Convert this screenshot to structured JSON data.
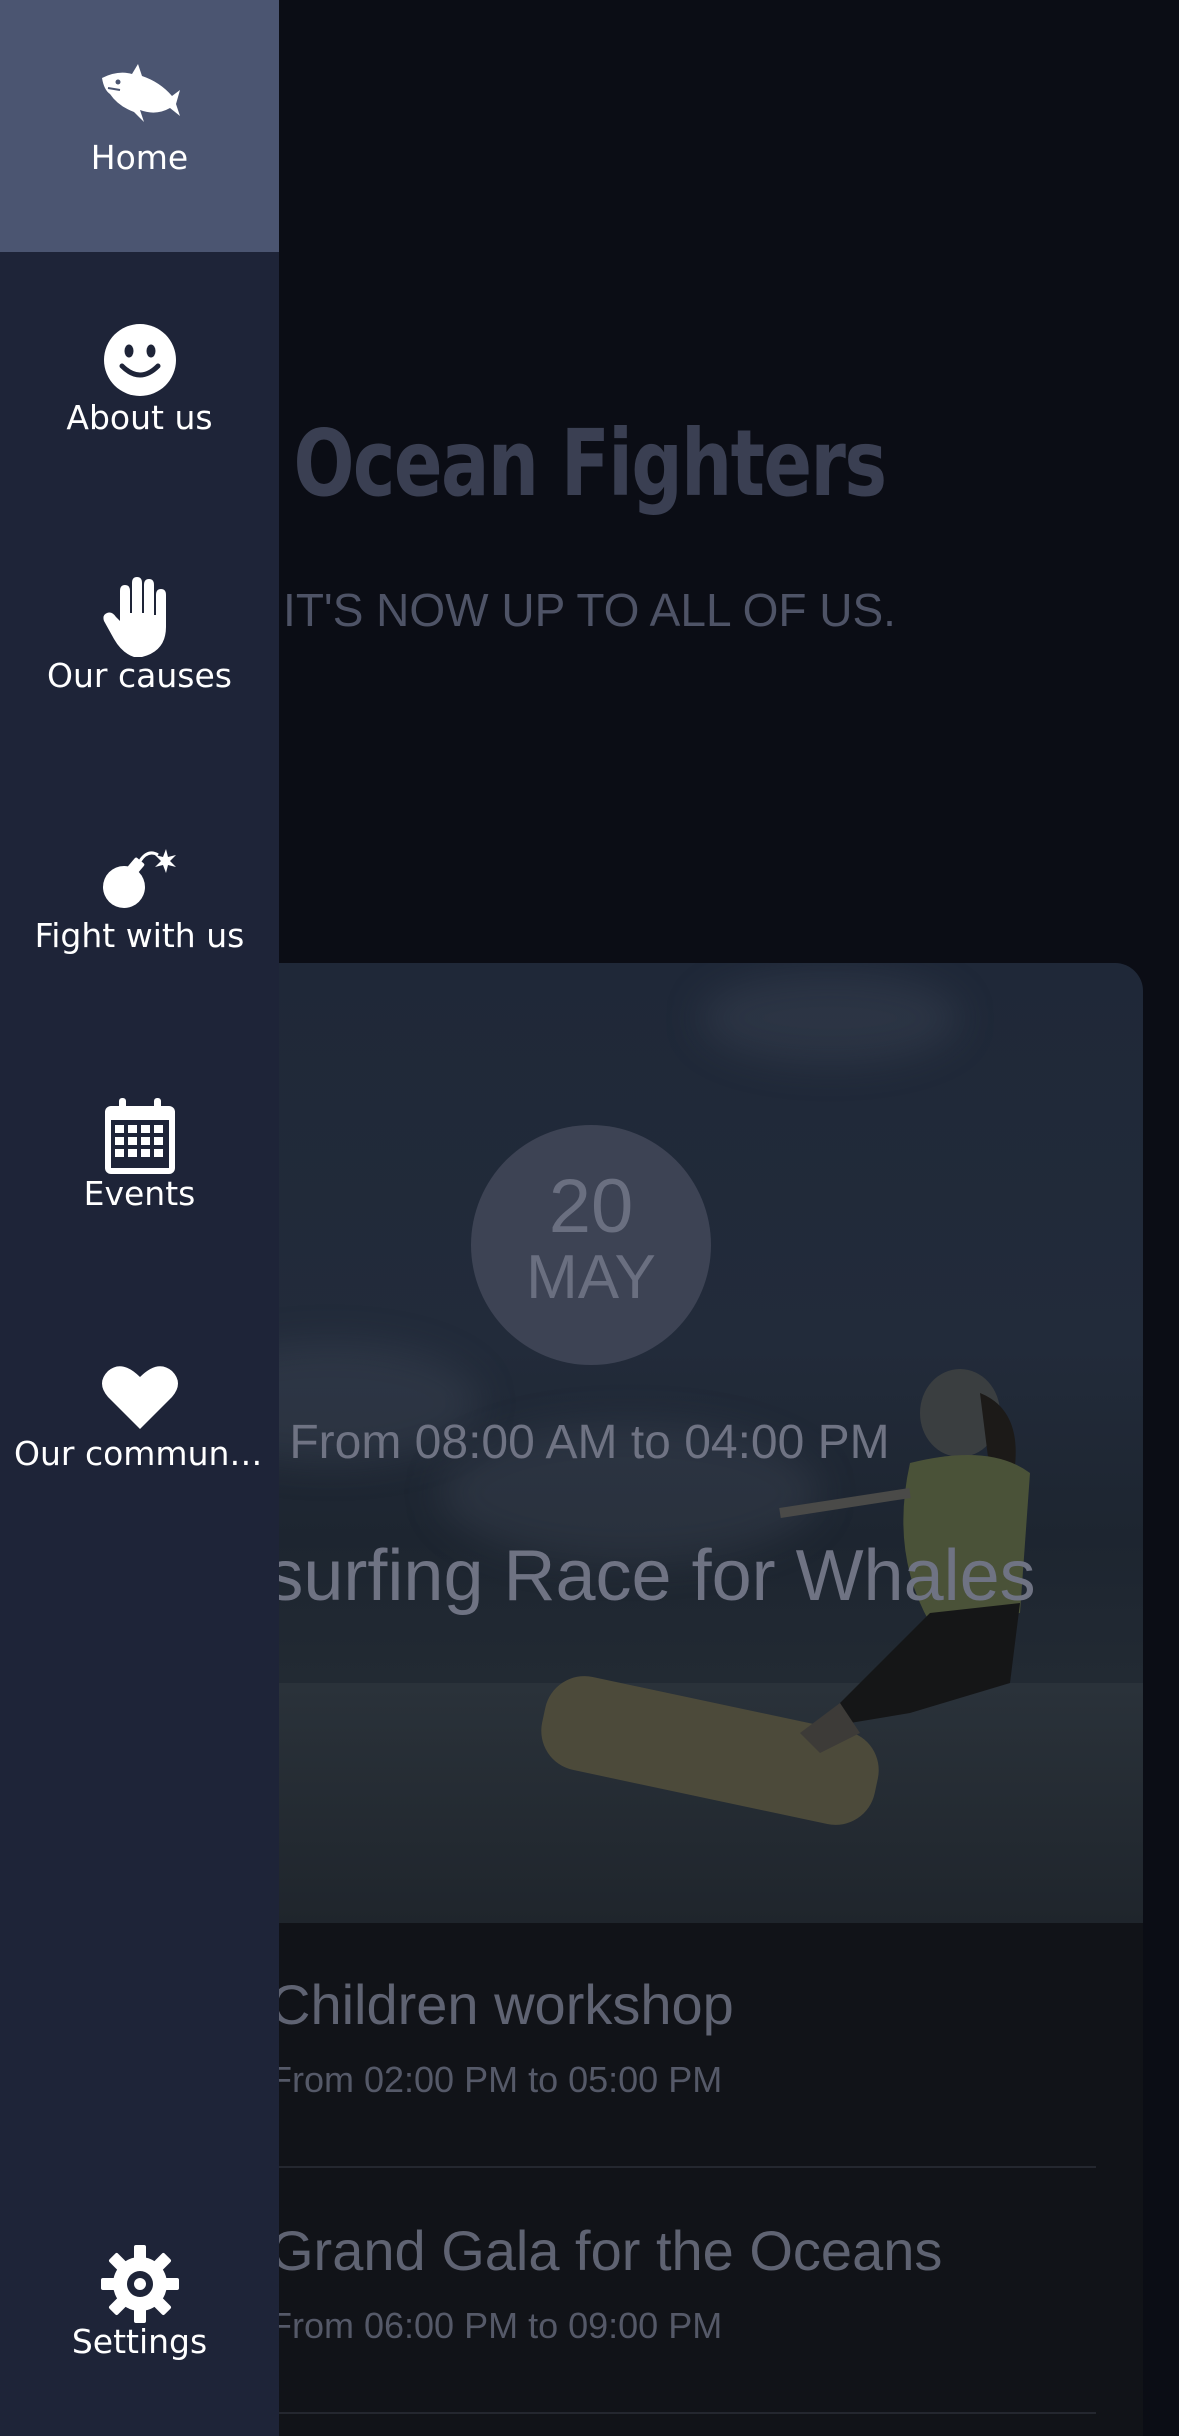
{
  "hero": {
    "title": "Ocean Fighters",
    "subtitle": "IT'S NOW UP TO ALL OF US."
  },
  "featured_event": {
    "day": "20",
    "month": "MAY",
    "time": "From 08:00 AM to 04:00 PM",
    "title": "Kitesurfing Race for Whales"
  },
  "events": [
    {
      "title": "Children workshop",
      "time": "From 02:00 PM to 05:00 PM"
    },
    {
      "title": "Grand Gala for the Oceans",
      "time": "From 06:00 PM to 09:00 PM"
    }
  ],
  "drawer": {
    "items": [
      {
        "label": "Home",
        "icon": "shark-icon",
        "active": true
      },
      {
        "label": "About us",
        "icon": "smile-icon",
        "active": false
      },
      {
        "label": "Our causes",
        "icon": "hand-icon",
        "active": false
      },
      {
        "label": "Fight with us",
        "icon": "bomb-icon",
        "active": false
      },
      {
        "label": "Events",
        "icon": "calendar-icon",
        "active": false
      },
      {
        "label": "Our community",
        "icon": "heart-icon",
        "active": false
      }
    ],
    "settings": {
      "label": "Settings",
      "icon": "gear-icon"
    }
  },
  "colors": {
    "drawer_bg": "#1e2438",
    "drawer_active": "#4b5571",
    "page_bg": "#0b0d15"
  }
}
